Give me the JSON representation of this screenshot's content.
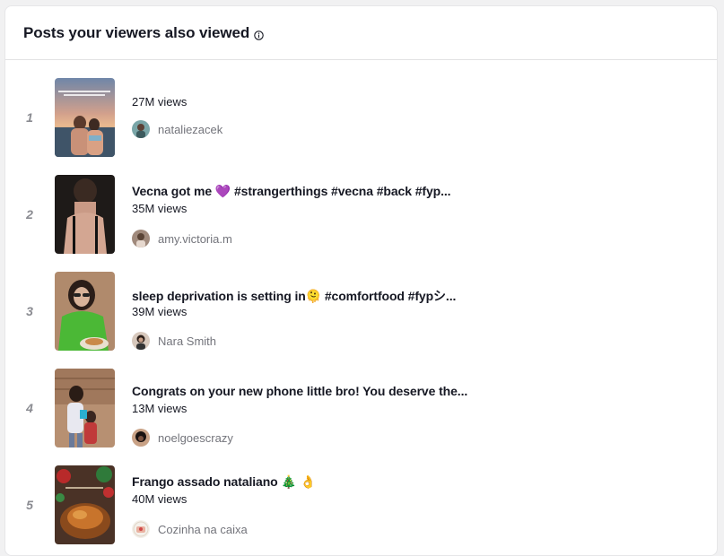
{
  "header": {
    "title": "Posts your viewers also viewed"
  },
  "posts": [
    {
      "rank": "1",
      "caption": "",
      "views": "27M views",
      "author": "nataliezacek"
    },
    {
      "rank": "2",
      "caption": "Vecna got me 💜 #strangerthings #vecna #back #fyp...",
      "views": "35M views",
      "author": "amy.victoria.m"
    },
    {
      "rank": "3",
      "caption": "sleep deprivation is setting in🫠 #comfortfood #fypシ...",
      "views": "39M views",
      "author": "Nara Smith"
    },
    {
      "rank": "4",
      "caption": "Congrats on your new phone little bro! You deserve the...",
      "views": "13M views",
      "author": "noelgoescrazy"
    },
    {
      "rank": "5",
      "caption": "Frango assado nataliano 🎄 👌",
      "views": "40M views",
      "author": "Cozinha na caixa"
    }
  ]
}
